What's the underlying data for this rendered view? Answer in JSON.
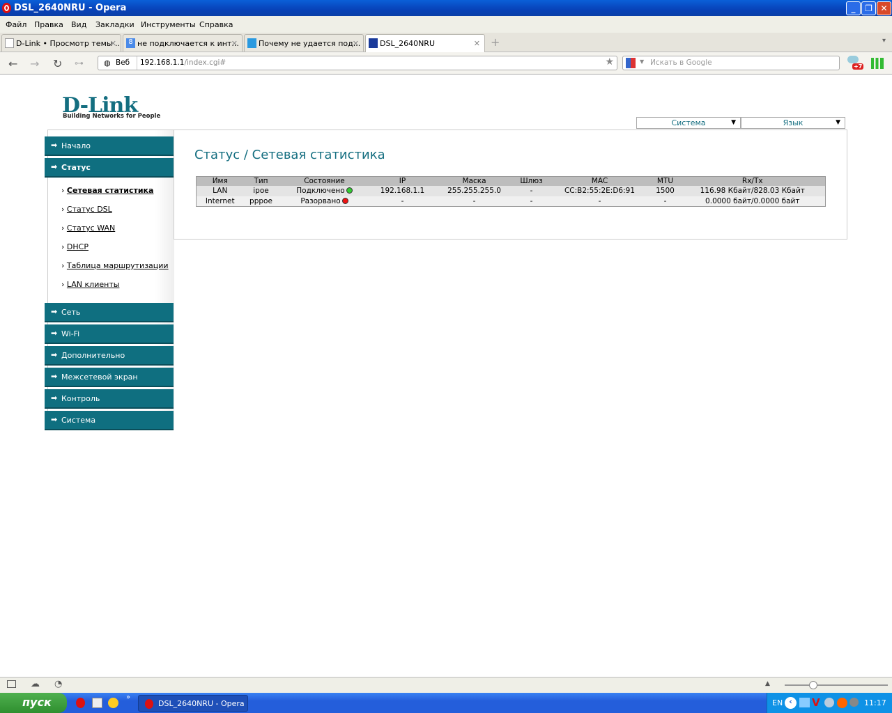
{
  "window": {
    "title": "DSL_2640NRU - Opera"
  },
  "menu": [
    "Файл",
    "Правка",
    "Вид",
    "Закладки",
    "Инструменты",
    "Справка"
  ],
  "tabs": [
    {
      "label": "D-Link • Просмотр темы ..."
    },
    {
      "label": "не подключается к инт..."
    },
    {
      "label": "Почему не удается под..."
    },
    {
      "label": "DSL_2640NRU"
    }
  ],
  "address": {
    "badge": "Веб",
    "host": "192.168.1.1",
    "path": "/index.cgi#",
    "search_placeholder": "Искать в Google",
    "notif_badge": "+7"
  },
  "page": {
    "logo": "D-Link",
    "logo_tagline": "Building Networks for People",
    "top_selects": [
      "Система",
      "Язык"
    ],
    "sidebar": {
      "top": [
        {
          "label": "Начало"
        },
        {
          "label": "Статус"
        }
      ],
      "sub": [
        {
          "label": "Сетевая статистика"
        },
        {
          "label": "Статус DSL"
        },
        {
          "label": "Статус WAN"
        },
        {
          "label": "DHCP"
        },
        {
          "label": "Таблица маршрутизации"
        },
        {
          "label": "LAN клиенты"
        }
      ],
      "bottom": [
        {
          "label": "Сеть"
        },
        {
          "label": "Wi-Fi"
        },
        {
          "label": "Дополнительно"
        },
        {
          "label": "Межсетевой экран"
        },
        {
          "label": "Контроль"
        },
        {
          "label": "Система"
        }
      ]
    },
    "title": "Статус / Сетевая статистика",
    "table": {
      "headers": [
        "Имя",
        "Тип",
        "Состояние",
        "IP",
        "Маска",
        "Шлюз",
        "MAC",
        "MTU",
        "Rx/Tx"
      ],
      "rows": [
        {
          "name": "LAN",
          "type": "ipoe",
          "state": "Подключено",
          "state_color": "#3c3",
          "ip": "192.168.1.1",
          "mask": "255.255.255.0",
          "gw": "-",
          "mac": "CC:B2:55:2E:D6:91",
          "mtu": "1500",
          "rxtx": "116.98 Кбайт/828.03 Кбайт"
        },
        {
          "name": "Internet",
          "type": "pppoe",
          "state": "Разорвано",
          "state_color": "#e11",
          "ip": "-",
          "mask": "-",
          "gw": "-",
          "mac": "-",
          "mtu": "-",
          "rxtx": "0.0000 байт/0.0000 байт"
        }
      ]
    }
  },
  "taskbar": {
    "start": "пуск",
    "task": "DSL_2640NRU - Opera",
    "lang": "EN",
    "clock": "11:17"
  }
}
